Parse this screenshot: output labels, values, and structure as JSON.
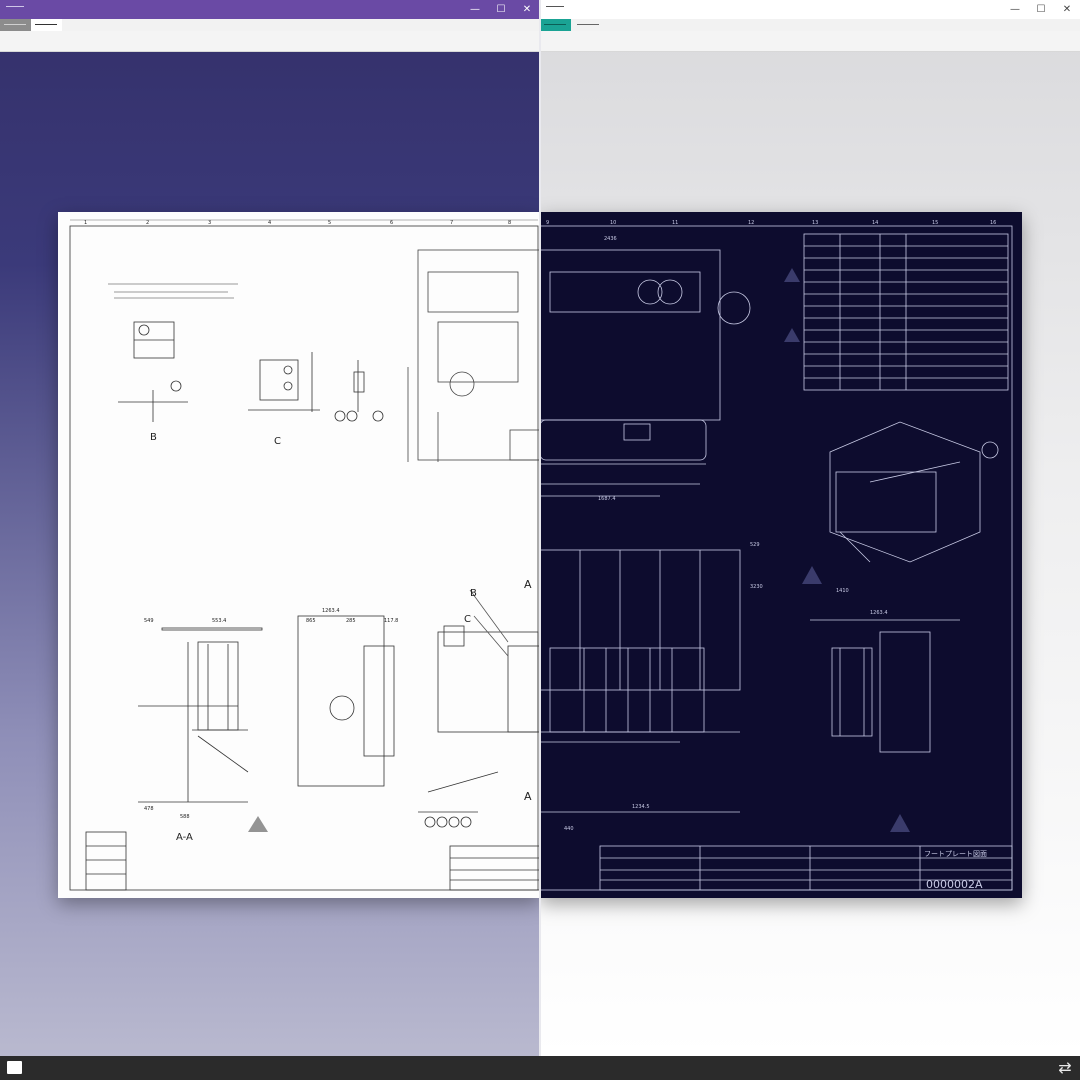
{
  "left_window": {
    "title": "",
    "controls": {
      "minimize": "—",
      "maximize": "☐",
      "close": "✕"
    },
    "tabs": [
      {
        "label": "",
        "active": false
      },
      {
        "label": "",
        "active": true
      }
    ],
    "accent": "#6a4aa5"
  },
  "right_window": {
    "title": "",
    "controls": {
      "minimize": "—",
      "maximize": "☐",
      "close": "✕"
    },
    "tabs": [
      {
        "label": "",
        "active": true
      },
      {
        "label": "",
        "active": false
      }
    ],
    "accent": "#1aa394"
  },
  "drawing": {
    "column_numbers": [
      "1",
      "2",
      "3",
      "4",
      "5",
      "6",
      "7",
      "8",
      "9",
      "10",
      "11",
      "12",
      "13",
      "14",
      "15",
      "16"
    ],
    "section_labels": [
      "B",
      "C",
      "A-A",
      "A",
      "A",
      "B",
      "C"
    ],
    "dimensions": [
      "549",
      "553.4",
      "1263.4",
      "865",
      "285",
      "117.8",
      "478",
      "588",
      "2436",
      "1687.4",
      "3230",
      "1410",
      "1234.5",
      "440",
      "1263.4",
      "529"
    ],
    "drawing_number": "0000002A",
    "title_block_name": "フートプレート図面"
  },
  "taskbar": {
    "start": "start",
    "swap": "⇄"
  }
}
